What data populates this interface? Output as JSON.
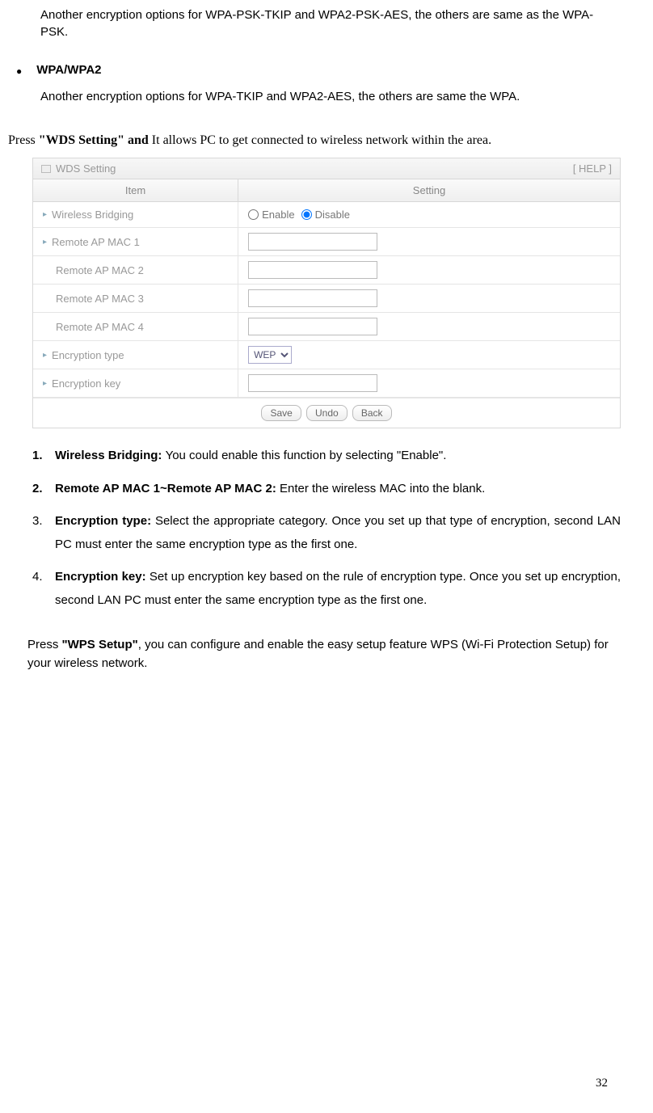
{
  "intro": {
    "para1": "Another encryption options for WPA-PSK-TKIP and WPA2-PSK-AES, the others are same as the WPA-PSK.",
    "bullet_title": "WPA/WPA2",
    "bullet_body": "Another encryption options for WPA-TKIP and WPA2-AES, the others are same the WPA."
  },
  "press_wds": {
    "prefix": "Press ",
    "bold": "\"WDS Setting\" and ",
    "rest": "It allows PC to get connected to wireless network within the area."
  },
  "wds": {
    "title": "WDS Setting",
    "help": "[ HELP ]",
    "col_item": "Item",
    "col_setting": "Setting",
    "rows": {
      "bridging": {
        "label": "Wireless Bridging",
        "opt_enable": "Enable",
        "opt_disable": "Disable"
      },
      "mac1": {
        "label": "Remote AP MAC 1",
        "value": ""
      },
      "mac2": {
        "label": "Remote AP MAC 2",
        "value": ""
      },
      "mac3": {
        "label": "Remote AP MAC 3",
        "value": ""
      },
      "mac4": {
        "label": "Remote AP MAC 4",
        "value": ""
      },
      "enctype": {
        "label": "Encryption type",
        "selected": "WEP"
      },
      "enckey": {
        "label": "Encryption key",
        "value": ""
      }
    },
    "buttons": {
      "save": "Save",
      "undo": "Undo",
      "back": "Back"
    }
  },
  "list": {
    "i1": {
      "num": "1.",
      "bold": "Wireless Bridging: ",
      "text": "You could enable this function by selecting \"Enable\"."
    },
    "i2": {
      "num": "2.",
      "bold": "Remote AP MAC 1~Remote AP MAC 2: ",
      "text": "Enter the wireless MAC into the blank."
    },
    "i3": {
      "num": "3.",
      "bold": "Encryption type: ",
      "text": "Select the appropriate category. Once you set up that type of encryption, second LAN PC must enter the same encryption type as the first one."
    },
    "i4": {
      "num": "4.",
      "bold": "Encryption key: ",
      "text": "Set up encryption key based on the rule of encryption type. Once you set up encryption, second LAN PC must enter the same encryption type as the first one."
    }
  },
  "press_wps": {
    "prefix": "Press ",
    "bold": "\"WPS Setup\"",
    "rest": ", you can configure and enable the easy setup feature WPS (Wi-Fi Protection Setup) for your wireless network."
  },
  "page_number": "32"
}
